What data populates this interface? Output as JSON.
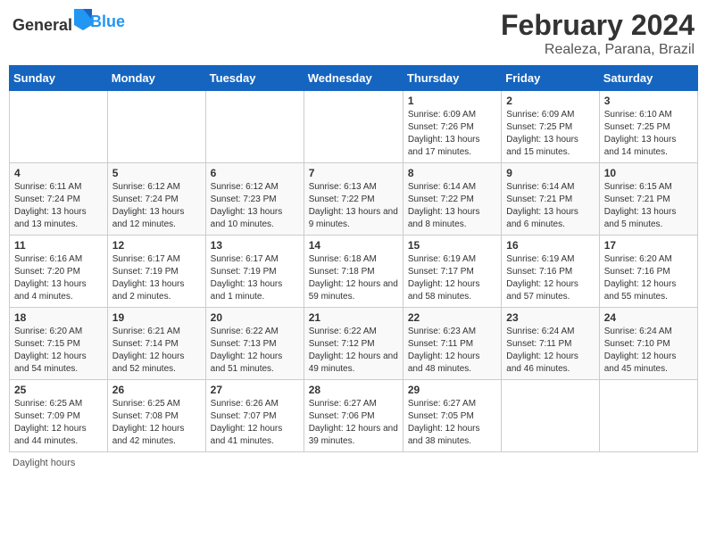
{
  "header": {
    "logo_general": "General",
    "logo_blue": "Blue",
    "title": "February 2024",
    "subtitle": "Realeza, Parana, Brazil"
  },
  "days_of_week": [
    "Sunday",
    "Monday",
    "Tuesday",
    "Wednesday",
    "Thursday",
    "Friday",
    "Saturday"
  ],
  "weeks": [
    [
      {
        "day": "",
        "info": ""
      },
      {
        "day": "",
        "info": ""
      },
      {
        "day": "",
        "info": ""
      },
      {
        "day": "",
        "info": ""
      },
      {
        "day": "1",
        "info": "Sunrise: 6:09 AM\nSunset: 7:26 PM\nDaylight: 13 hours and 17 minutes."
      },
      {
        "day": "2",
        "info": "Sunrise: 6:09 AM\nSunset: 7:25 PM\nDaylight: 13 hours and 15 minutes."
      },
      {
        "day": "3",
        "info": "Sunrise: 6:10 AM\nSunset: 7:25 PM\nDaylight: 13 hours and 14 minutes."
      }
    ],
    [
      {
        "day": "4",
        "info": "Sunrise: 6:11 AM\nSunset: 7:24 PM\nDaylight: 13 hours and 13 minutes."
      },
      {
        "day": "5",
        "info": "Sunrise: 6:12 AM\nSunset: 7:24 PM\nDaylight: 13 hours and 12 minutes."
      },
      {
        "day": "6",
        "info": "Sunrise: 6:12 AM\nSunset: 7:23 PM\nDaylight: 13 hours and 10 minutes."
      },
      {
        "day": "7",
        "info": "Sunrise: 6:13 AM\nSunset: 7:22 PM\nDaylight: 13 hours and 9 minutes."
      },
      {
        "day": "8",
        "info": "Sunrise: 6:14 AM\nSunset: 7:22 PM\nDaylight: 13 hours and 8 minutes."
      },
      {
        "day": "9",
        "info": "Sunrise: 6:14 AM\nSunset: 7:21 PM\nDaylight: 13 hours and 6 minutes."
      },
      {
        "day": "10",
        "info": "Sunrise: 6:15 AM\nSunset: 7:21 PM\nDaylight: 13 hours and 5 minutes."
      }
    ],
    [
      {
        "day": "11",
        "info": "Sunrise: 6:16 AM\nSunset: 7:20 PM\nDaylight: 13 hours and 4 minutes."
      },
      {
        "day": "12",
        "info": "Sunrise: 6:17 AM\nSunset: 7:19 PM\nDaylight: 13 hours and 2 minutes."
      },
      {
        "day": "13",
        "info": "Sunrise: 6:17 AM\nSunset: 7:19 PM\nDaylight: 13 hours and 1 minute."
      },
      {
        "day": "14",
        "info": "Sunrise: 6:18 AM\nSunset: 7:18 PM\nDaylight: 12 hours and 59 minutes."
      },
      {
        "day": "15",
        "info": "Sunrise: 6:19 AM\nSunset: 7:17 PM\nDaylight: 12 hours and 58 minutes."
      },
      {
        "day": "16",
        "info": "Sunrise: 6:19 AM\nSunset: 7:16 PM\nDaylight: 12 hours and 57 minutes."
      },
      {
        "day": "17",
        "info": "Sunrise: 6:20 AM\nSunset: 7:16 PM\nDaylight: 12 hours and 55 minutes."
      }
    ],
    [
      {
        "day": "18",
        "info": "Sunrise: 6:20 AM\nSunset: 7:15 PM\nDaylight: 12 hours and 54 minutes."
      },
      {
        "day": "19",
        "info": "Sunrise: 6:21 AM\nSunset: 7:14 PM\nDaylight: 12 hours and 52 minutes."
      },
      {
        "day": "20",
        "info": "Sunrise: 6:22 AM\nSunset: 7:13 PM\nDaylight: 12 hours and 51 minutes."
      },
      {
        "day": "21",
        "info": "Sunrise: 6:22 AM\nSunset: 7:12 PM\nDaylight: 12 hours and 49 minutes."
      },
      {
        "day": "22",
        "info": "Sunrise: 6:23 AM\nSunset: 7:11 PM\nDaylight: 12 hours and 48 minutes."
      },
      {
        "day": "23",
        "info": "Sunrise: 6:24 AM\nSunset: 7:11 PM\nDaylight: 12 hours and 46 minutes."
      },
      {
        "day": "24",
        "info": "Sunrise: 6:24 AM\nSunset: 7:10 PM\nDaylight: 12 hours and 45 minutes."
      }
    ],
    [
      {
        "day": "25",
        "info": "Sunrise: 6:25 AM\nSunset: 7:09 PM\nDaylight: 12 hours and 44 minutes."
      },
      {
        "day": "26",
        "info": "Sunrise: 6:25 AM\nSunset: 7:08 PM\nDaylight: 12 hours and 42 minutes."
      },
      {
        "day": "27",
        "info": "Sunrise: 6:26 AM\nSunset: 7:07 PM\nDaylight: 12 hours and 41 minutes."
      },
      {
        "day": "28",
        "info": "Sunrise: 6:27 AM\nSunset: 7:06 PM\nDaylight: 12 hours and 39 minutes."
      },
      {
        "day": "29",
        "info": "Sunrise: 6:27 AM\nSunset: 7:05 PM\nDaylight: 12 hours and 38 minutes."
      },
      {
        "day": "",
        "info": ""
      },
      {
        "day": "",
        "info": ""
      }
    ]
  ],
  "footer": "Daylight hours"
}
